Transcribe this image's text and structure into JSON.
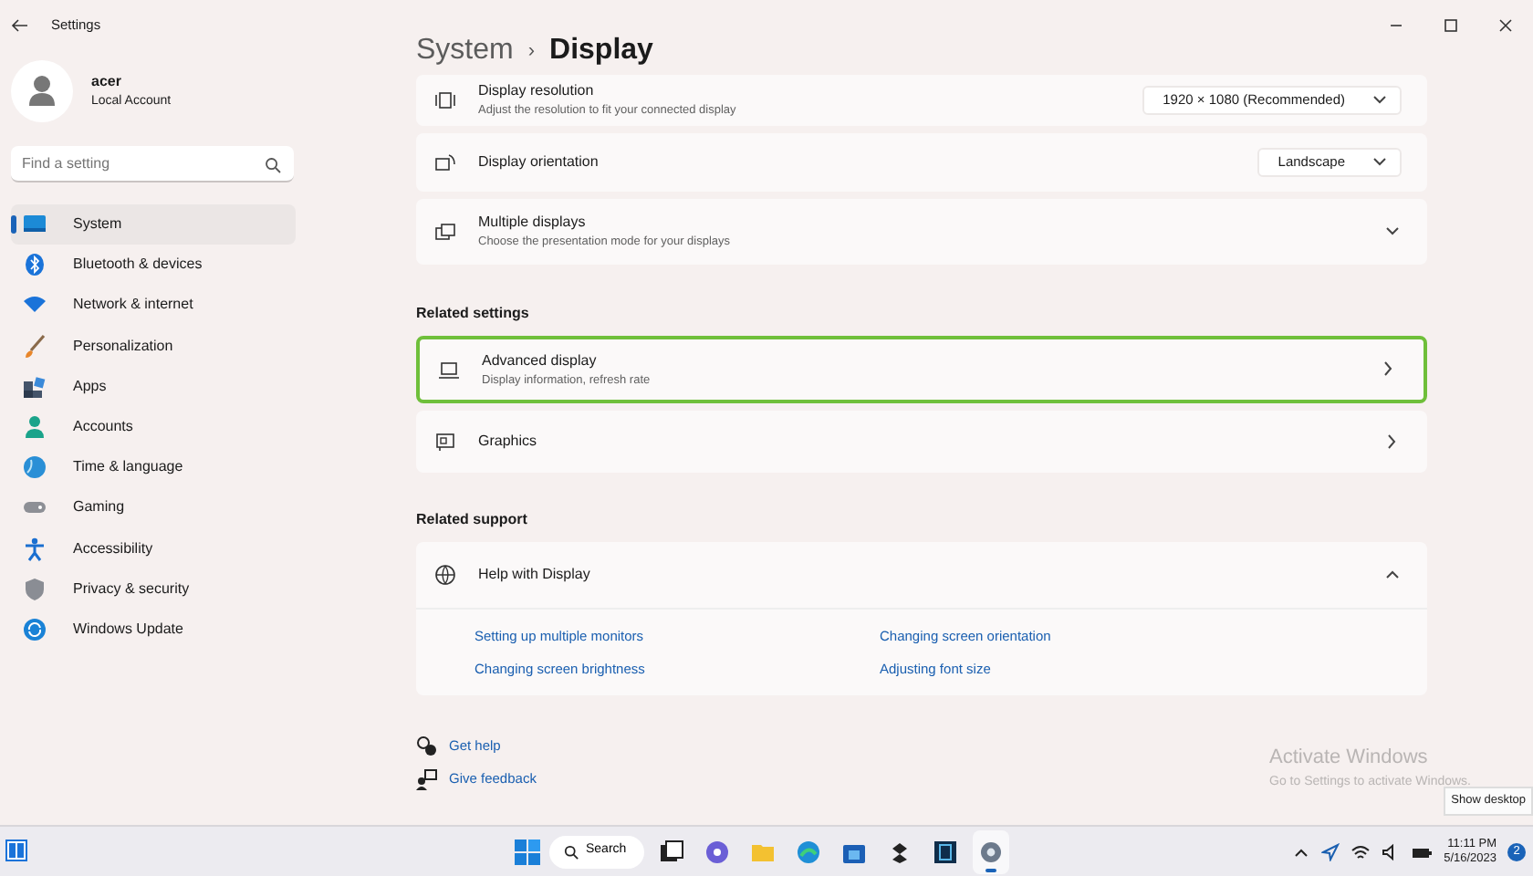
{
  "window": {
    "title": "Settings"
  },
  "account": {
    "name": "acer",
    "type": "Local Account"
  },
  "search": {
    "placeholder": "Find a setting"
  },
  "nav": [
    {
      "label": "System",
      "selected": true
    },
    {
      "label": "Bluetooth & devices",
      "selected": false
    },
    {
      "label": "Network & internet",
      "selected": false
    },
    {
      "label": "Personalization",
      "selected": false
    },
    {
      "label": "Apps",
      "selected": false
    },
    {
      "label": "Accounts",
      "selected": false
    },
    {
      "label": "Time & language",
      "selected": false
    },
    {
      "label": "Gaming",
      "selected": false
    },
    {
      "label": "Accessibility",
      "selected": false
    },
    {
      "label": "Privacy & security",
      "selected": false
    },
    {
      "label": "Windows Update",
      "selected": false
    }
  ],
  "breadcrumb": {
    "parent": "System",
    "separator": "›",
    "current": "Display"
  },
  "display_settings": [
    {
      "kind": "dropdown",
      "title": "Display resolution",
      "subtitle": "Adjust the resolution to fit your connected display",
      "value": "1920 × 1080 (Recommended)"
    },
    {
      "kind": "dropdown",
      "title": "Display orientation",
      "value": "Landscape"
    },
    {
      "kind": "expander",
      "title": "Multiple displays",
      "subtitle": "Choose the presentation mode for your displays",
      "expanded": false
    }
  ],
  "related_settings": {
    "heading": "Related settings",
    "items": [
      {
        "title": "Advanced display",
        "subtitle": "Display information, refresh rate",
        "highlighted": true
      },
      {
        "title": "Graphics",
        "highlighted": false
      }
    ]
  },
  "related_support": {
    "heading": "Related support",
    "help": {
      "title": "Help with Display",
      "expanded": true,
      "links": [
        "Setting up multiple monitors",
        "Changing screen orientation",
        "Changing screen brightness",
        "Adjusting font size"
      ]
    }
  },
  "footer_links": [
    "Get help",
    "Give feedback"
  ],
  "activation_notice": {
    "title": "Activate Windows",
    "subtitle": "Go to Settings to activate Windows."
  },
  "tooltip": "Show desktop",
  "taskbar": {
    "search_label": "Search",
    "apps": [
      {
        "active": false
      },
      {
        "active": false
      },
      {
        "active": false
      },
      {
        "active": false
      },
      {
        "active": false
      },
      {
        "active": false
      },
      {
        "active": false
      },
      {
        "active": true
      }
    ],
    "time": "11:11 PM",
    "date": "5/16/2023",
    "notification_count": "2"
  }
}
